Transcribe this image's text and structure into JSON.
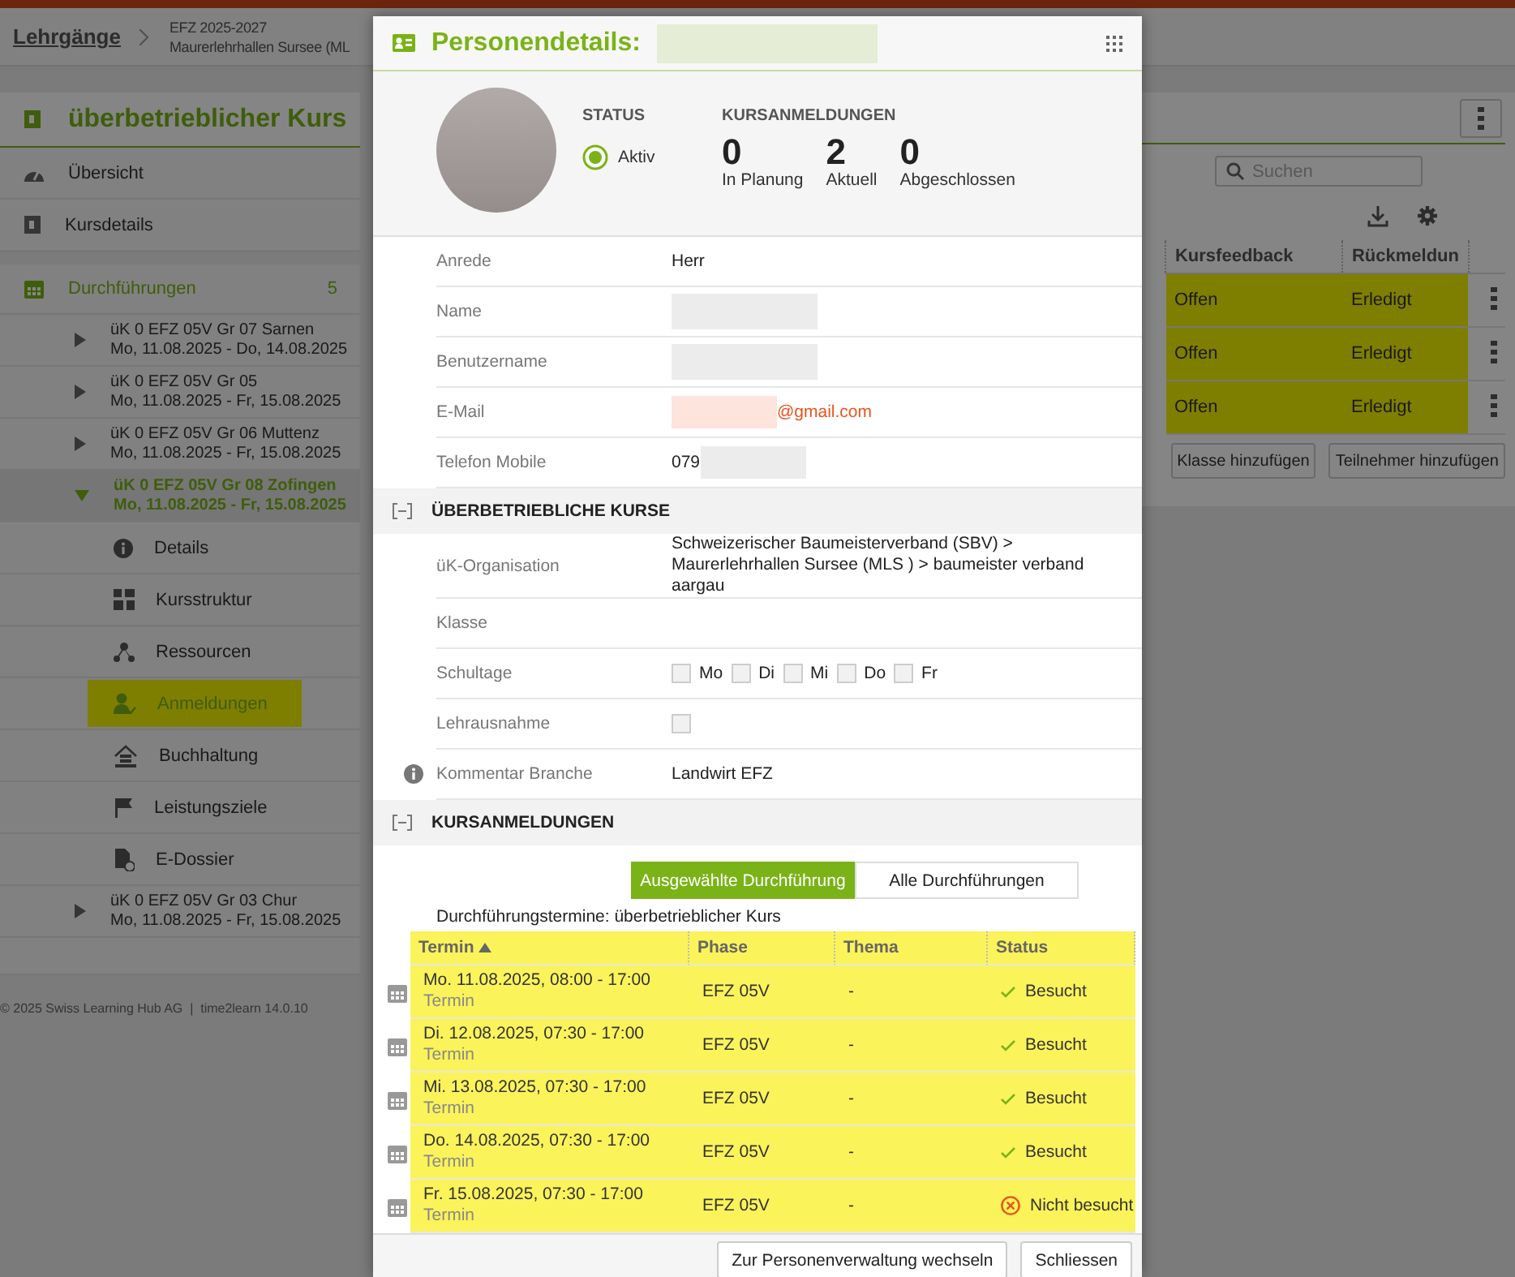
{
  "top_bar": {
    "breadcrumb_link": "Lehrgänge",
    "course_code": "EFZ 2025-2027",
    "course_name": "Maurerlehrhallen Sursee (ML"
  },
  "sidebar": {
    "title": "überbetrieblicher Kurs",
    "items": [
      {
        "label": "Übersicht",
        "selected": false
      },
      {
        "label": "Kursdetails",
        "selected": false
      }
    ],
    "runs_header": {
      "label": "Durchführungen",
      "count": "5"
    },
    "runs": [
      {
        "name": "üK 0 EFZ 05V Gr 07 Sarnen",
        "dates": "Mo, 11.08.2025 - Do, 14.08.2025",
        "expanded": false,
        "selected": false
      },
      {
        "name": "üK 0 EFZ 05V Gr 05",
        "dates": "Mo, 11.08.2025 - Fr, 15.08.2025",
        "expanded": false,
        "selected": false
      },
      {
        "name": "üK 0 EFZ 05V Gr 06 Muttenz",
        "dates": "Mo, 11.08.2025 - Fr, 15.08.2025",
        "expanded": false,
        "selected": false
      },
      {
        "name": "üK 0 EFZ 05V Gr 08 Zofingen",
        "dates": "Mo, 11.08.2025 - Fr, 15.08.2025",
        "expanded": true,
        "selected": true,
        "children": [
          {
            "label": "Details",
            "selected": false,
            "highlighted": false
          },
          {
            "label": "Kursstruktur",
            "selected": false,
            "highlighted": false
          },
          {
            "label": "Ressourcen",
            "selected": false,
            "highlighted": false
          },
          {
            "label": "Anmeldungen",
            "selected": true,
            "highlighted": true
          },
          {
            "label": "Buchhaltung",
            "selected": false,
            "highlighted": false
          },
          {
            "label": "Leistungsziele",
            "selected": false,
            "highlighted": false
          },
          {
            "label": "E-Dossier",
            "selected": false,
            "highlighted": false
          }
        ]
      },
      {
        "name": "üK 0 EFZ 05V Gr 03 Chur",
        "dates": "Mo, 11.08.2025 - Fr, 15.08.2025",
        "expanded": false,
        "selected": false
      }
    ]
  },
  "main": {
    "search": {
      "placeholder": "Suchen"
    },
    "table": {
      "columns": [
        "Kursfeedback",
        "Rückmeldun"
      ],
      "rows": [
        {
          "cells": [
            "Offen",
            "Erledigt"
          ],
          "highlighted": true
        },
        {
          "cells": [
            "Offen",
            "Erledigt"
          ],
          "highlighted": true
        },
        {
          "cells": [
            "Offen",
            "Erledigt"
          ],
          "highlighted": true
        }
      ]
    },
    "buttons": [
      "Klasse hinzufügen",
      "Teilnehmer hinzufügen"
    ]
  },
  "footer": "© 2025 Swiss Learning Hub AG  |  time2learn 14.0.10",
  "modal": {
    "title": "Personendetails:",
    "title_redacted": true,
    "status": {
      "label": "STATUS",
      "option": "Aktiv",
      "selected": true
    },
    "enrollments": {
      "label": "KURSANMELDUNGEN",
      "counts": [
        {
          "value": "0",
          "label": "In Planung"
        },
        {
          "value": "2",
          "label": "Aktuell"
        },
        {
          "value": "0",
          "label": "Abgeschlossen"
        }
      ]
    },
    "person_fields": [
      {
        "label": "Anrede",
        "kind": "text",
        "value": "Herr"
      },
      {
        "label": "Name",
        "kind": "text",
        "redacted": true
      },
      {
        "label": "Benutzername",
        "kind": "text",
        "redacted": true
      },
      {
        "label": "E-Mail",
        "kind": "email",
        "value": "@gmail.com",
        "redacted": true
      },
      {
        "label": "Telefon Mobile",
        "kind": "text",
        "value": "079",
        "redacted": true
      }
    ],
    "sections": [
      {
        "title": "ÜBERBETRIEBLICHE KURSE",
        "expanded": true,
        "fields": [
          {
            "label": "üK-Organisation",
            "kind": "text",
            "value": "Schweizerischer Baumeisterverband (SBV) > Maurerlehrhallen Sursee (MLS ) > baumeister verband aargau"
          },
          {
            "label": "Klasse",
            "kind": "text"
          },
          {
            "label": "Schultage",
            "kind": "weekdays",
            "options": [
              {
                "label": "Mo",
                "checked": false
              },
              {
                "label": "Di",
                "checked": false
              },
              {
                "label": "Mi",
                "checked": false
              },
              {
                "label": "Do",
                "checked": false
              },
              {
                "label": "Fr",
                "checked": false
              }
            ]
          },
          {
            "label": "Lehrausnahme",
            "kind": "checkbox",
            "checked": false
          },
          {
            "label": "Kommentar Branche",
            "kind": "text",
            "value": "Landwirt EFZ",
            "info": true
          }
        ]
      },
      {
        "title": "KURSANMELDUNGEN",
        "expanded": true,
        "tabs": [
          {
            "label": "Ausgewählte Durchführung",
            "selected": true
          },
          {
            "label": "Alle Durchführungen",
            "selected": false
          }
        ],
        "caption": "Durchführungstermine: überbetrieblicher Kurs",
        "table": {
          "highlighted": true,
          "columns": [
            {
              "label": "Termin",
              "sorted": true
            },
            {
              "label": "Phase"
            },
            {
              "label": "Thema"
            },
            {
              "label": "Status"
            }
          ],
          "rows": [
            {
              "date": "Mo. 11.08.2025, 08:00 - 17:00",
              "type": "Termin",
              "phase": "EFZ 05V",
              "topic": "-",
              "status": "Besucht",
              "kind": "visited"
            },
            {
              "date": "Di. 12.08.2025, 07:30 - 17:00",
              "type": "Termin",
              "phase": "EFZ 05V",
              "topic": "-",
              "status": "Besucht",
              "kind": "visited"
            },
            {
              "date": "Mi. 13.08.2025, 07:30 - 17:00",
              "type": "Termin",
              "phase": "EFZ 05V",
              "topic": "-",
              "status": "Besucht",
              "kind": "visited"
            },
            {
              "date": "Do. 14.08.2025, 07:30 - 17:00",
              "type": "Termin",
              "phase": "EFZ 05V",
              "topic": "-",
              "status": "Besucht",
              "kind": "visited"
            },
            {
              "date": "Fr. 15.08.2025, 07:30 - 17:00",
              "type": "Termin",
              "phase": "EFZ 05V",
              "topic": "-",
              "status": "Nicht besucht",
              "kind": "missed"
            }
          ]
        }
      }
    ],
    "buttons": [
      "Zur Personenverwaltung wechseln",
      "Schliessen"
    ]
  }
}
